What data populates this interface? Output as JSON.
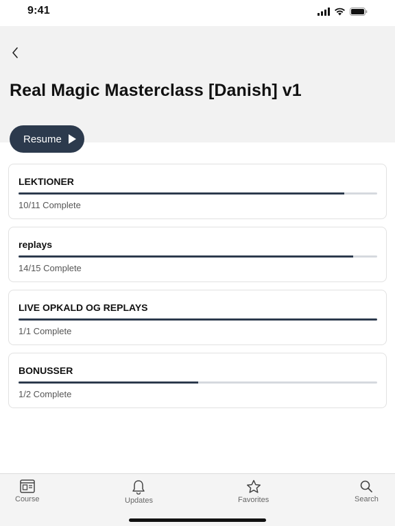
{
  "status_bar": {
    "time": "9:41"
  },
  "header": {
    "title": "Real Magic Masterclass [Danish] v1",
    "resume_label": "Resume"
  },
  "modules": [
    {
      "title": "LEKTIONER",
      "status": "10/11 Complete",
      "progress": 0.909
    },
    {
      "title": "replays",
      "status": "14/15 Complete",
      "progress": 0.933
    },
    {
      "title": "LIVE OPKALD OG REPLAYS",
      "status": "1/1 Complete",
      "progress": 1.0
    },
    {
      "title": "BONUSSER",
      "status": "1/2 Complete",
      "progress": 0.5
    }
  ],
  "tab_bar": {
    "tabs": [
      {
        "label": "Course",
        "icon": "course-icon"
      },
      {
        "label": "Updates",
        "icon": "bell-icon"
      },
      {
        "label": "Favorites",
        "icon": "star-icon"
      },
      {
        "label": "Search",
        "icon": "search-icon"
      }
    ]
  },
  "colors": {
    "accent": "#2c3a4d",
    "header_bg": "#f2f2f2",
    "tab_bar_bg": "#f4f4f4"
  }
}
